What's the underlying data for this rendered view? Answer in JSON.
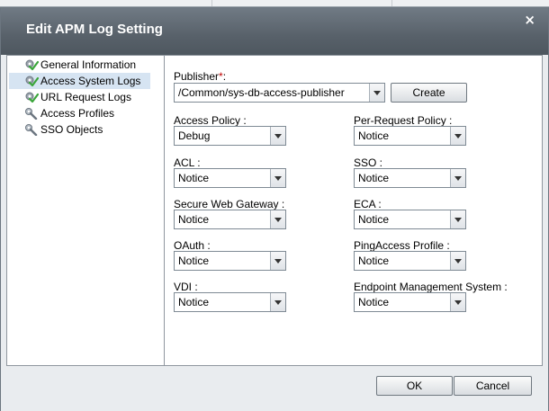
{
  "dialog": {
    "title": "Edit APM Log Setting",
    "close_glyph": "×"
  },
  "sidebar": {
    "items": [
      {
        "label": "General Information",
        "icon": "gear-check-icon",
        "selected": false
      },
      {
        "label": "Access System Logs",
        "icon": "gear-check-icon",
        "selected": true
      },
      {
        "label": "URL Request Logs",
        "icon": "gear-check-icon",
        "selected": false
      },
      {
        "label": "Access Profiles",
        "icon": "wrench-icon",
        "selected": false
      },
      {
        "label": "SSO Objects",
        "icon": "wrench-icon",
        "selected": false
      }
    ]
  },
  "publisher": {
    "label": "Publisher",
    "required_mark": "*",
    "label_suffix": ":",
    "value": "/Common/sys-db-access-publisher",
    "create_label": "Create"
  },
  "log_levels": {
    "left": [
      {
        "label": "Access Policy :",
        "value": "Debug"
      },
      {
        "label": "ACL :",
        "value": "Notice"
      },
      {
        "label": "Secure Web Gateway :",
        "value": "Notice"
      },
      {
        "label": "OAuth :",
        "value": "Notice"
      },
      {
        "label": "VDI :",
        "value": "Notice"
      }
    ],
    "right": [
      {
        "label": "Per-Request Policy :",
        "value": "Notice"
      },
      {
        "label": "SSO :",
        "value": "Notice"
      },
      {
        "label": "ECA :",
        "value": "Notice"
      },
      {
        "label": "PingAccess Profile :",
        "value": "Notice"
      },
      {
        "label": "Endpoint Management System :",
        "value": "Notice"
      }
    ]
  },
  "footer": {
    "ok_label": "OK",
    "cancel_label": "Cancel"
  },
  "colors": {
    "titlebar": "#58616a",
    "selected_nav": "#d6e4f2",
    "required_mark": "#c00000",
    "check_green": "#3aa53a"
  }
}
